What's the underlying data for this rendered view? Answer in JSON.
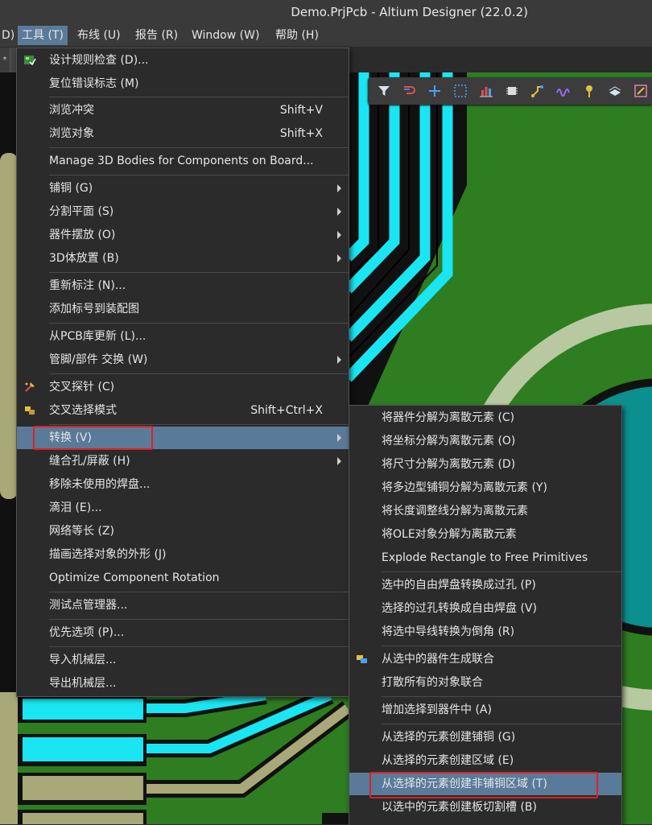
{
  "window": {
    "title": "Demo.PrjPcb - Altium Designer (22.0.2)"
  },
  "menubar": {
    "items": [
      {
        "label": "D)"
      },
      {
        "label": "工具 (T)"
      },
      {
        "label": "布线 (U)"
      },
      {
        "label": "报告 (R)"
      },
      {
        "label": "Window (W)"
      },
      {
        "label": "帮助 (H)"
      }
    ]
  },
  "document_tab": {
    "label": "*"
  },
  "pcb_toolbar": {
    "icons": [
      "filter-icon",
      "route-icon",
      "add-icon",
      "select-rect-icon",
      "chart-icon",
      "component-icon",
      "interactive-route-icon",
      "wave-icon",
      "pin-icon",
      "layer-icon",
      "edit-icon"
    ]
  },
  "tools_menu": {
    "items": [
      {
        "label": "设计规则检查 (D)...",
        "shortcut": "",
        "icon": "drc-icon",
        "submenu": false
      },
      {
        "label": "复位错误标志 (M)",
        "shortcut": "",
        "submenu": false
      },
      {
        "label": "浏览冲突",
        "shortcut": "Shift+V",
        "submenu": false
      },
      {
        "label": "浏览对象",
        "shortcut": "Shift+X",
        "submenu": false
      },
      {
        "label": "Manage 3D Bodies for Components on Board...",
        "shortcut": "",
        "submenu": false
      },
      {
        "label": "铺铜 (G)",
        "shortcut": "",
        "submenu": true
      },
      {
        "label": "分割平面 (S)",
        "shortcut": "",
        "submenu": true
      },
      {
        "label": "器件摆放 (O)",
        "shortcut": "",
        "submenu": true
      },
      {
        "label": "3D体放置 (B)",
        "shortcut": "",
        "submenu": true
      },
      {
        "label": "重新标注 (N)...",
        "shortcut": "",
        "submenu": false
      },
      {
        "label": "添加标号到装配图",
        "shortcut": "",
        "submenu": false
      },
      {
        "label": "从PCB库更新 (L)...",
        "shortcut": "",
        "submenu": false
      },
      {
        "label": "管脚/部件 交换 (W)",
        "shortcut": "",
        "submenu": true
      },
      {
        "label": "交叉探针 (C)",
        "shortcut": "",
        "icon": "cross-probe-icon",
        "submenu": false
      },
      {
        "label": "交叉选择模式",
        "shortcut": "Shift+Ctrl+X",
        "icon": "cross-select-icon",
        "submenu": false
      },
      {
        "label": "转换 (V)",
        "shortcut": "",
        "submenu": true
      },
      {
        "label": "缝合孔/屏蔽 (H)",
        "shortcut": "",
        "submenu": true
      },
      {
        "label": "移除未使用的焊盘...",
        "shortcut": "",
        "submenu": false
      },
      {
        "label": "滴泪 (E)...",
        "shortcut": "",
        "submenu": false
      },
      {
        "label": "网络等长 (Z)",
        "shortcut": "",
        "submenu": false
      },
      {
        "label": "描画选择对象的外形 (J)",
        "shortcut": "",
        "submenu": false
      },
      {
        "label": "Optimize Component Rotation",
        "shortcut": "",
        "submenu": false
      },
      {
        "label": "测试点管理器...",
        "shortcut": "",
        "submenu": false
      },
      {
        "label": "优先选项 (P)...",
        "shortcut": "",
        "submenu": false
      },
      {
        "label": "导入机械层...",
        "shortcut": "",
        "submenu": false
      },
      {
        "label": "导出机械层...",
        "shortcut": "",
        "submenu": false
      }
    ]
  },
  "convert_submenu": {
    "items": [
      {
        "label": "将器件分解为离散元素 (C)"
      },
      {
        "label": "将坐标分解为离散元素 (O)"
      },
      {
        "label": "将尺寸分解为离散元素 (D)"
      },
      {
        "label": "将多边型铺铜分解为离散元素 (Y)"
      },
      {
        "label": "将长度调整线分解为离散元素"
      },
      {
        "label": "将OLE对象分解为离散元素"
      },
      {
        "label": "Explode Rectangle to Free Primitives"
      },
      {
        "label": "选中的自由焊盘转换成过孔 (P)"
      },
      {
        "label": "选择的过孔转换成自由焊盘 (V)"
      },
      {
        "label": "将选中导线转换为倒角 (R)"
      },
      {
        "label": "从选中的器件生成联合",
        "icon": "union-icon"
      },
      {
        "label": "打散所有的对象联合"
      },
      {
        "label": "增加选择到器件中 (A)"
      },
      {
        "label": "从选择的元素创建铺铜 (G)"
      },
      {
        "label": "从选择的元素创建区域 (E)"
      },
      {
        "label": "从选择的元素创建非铺铜区域 (T)"
      },
      {
        "label": "以选中的元素创建板切割槽 (B)"
      }
    ]
  },
  "colors": {
    "menu_bg": "#2b2b2b",
    "highlight": "#5a7a9a",
    "annotation_red": "#e02020",
    "pcb_green": "#2e7d20",
    "trace_cyan": "#19e6f2",
    "pad_tan": "#a8a878",
    "pad_teal": "#0b8f8f"
  }
}
